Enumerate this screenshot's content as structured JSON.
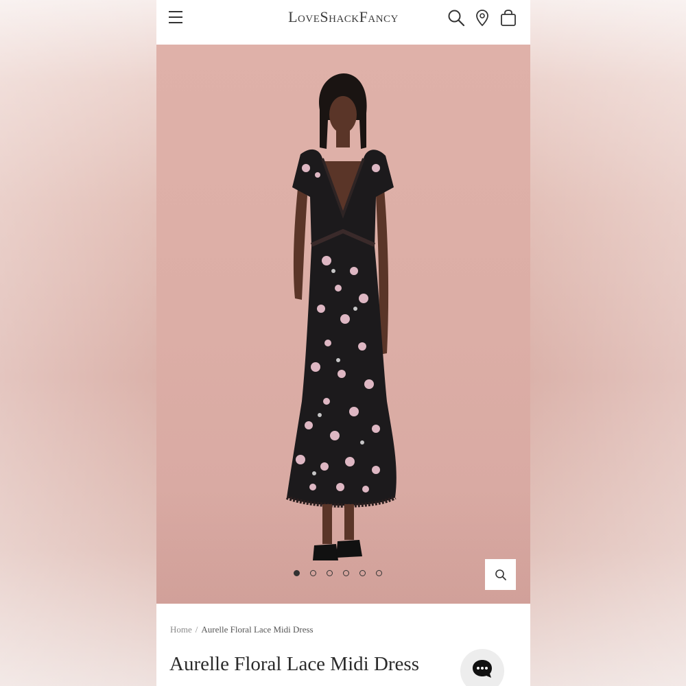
{
  "header": {
    "logo_love": "L",
    "logo_love_rest": "ove",
    "logo_shack": "S",
    "logo_shack_rest": "hack",
    "logo_fancy": "F",
    "logo_fancy_rest": "ancy",
    "icons": [
      "hamburger-menu-icon",
      "search-icon",
      "location-pin-icon",
      "shopping-bag-icon"
    ]
  },
  "gallery": {
    "image_count": 6,
    "active_index": 0,
    "colors": {
      "background": "#dcaea6",
      "dress": "#1c1a1c",
      "flowers": "#f3c9d6"
    }
  },
  "breadcrumb": {
    "home": "Home",
    "separator": "/",
    "current": "Aurelle Floral Lace Midi Dress"
  },
  "product": {
    "title": "Aurelle Floral Lace Midi Dress"
  }
}
